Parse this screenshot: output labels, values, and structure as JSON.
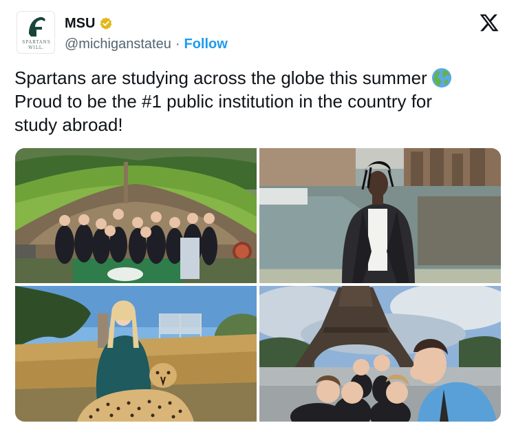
{
  "account": {
    "display_name": "MSU",
    "handle": "@michiganstateu",
    "separator": "·",
    "follow_label": "Follow",
    "avatar_tagline_line1": "SPARTANS",
    "avatar_tagline_line2": "WILL."
  },
  "tweet": {
    "line1": "Spartans are studying across the globe this summer",
    "line2": "Proud to be the #1 public institution in the country for",
    "line3": "study abroad!"
  },
  "icons": {
    "brand": "spartan-helmet-icon",
    "verified": "verified-badge-icon",
    "platform": "x-logo-icon",
    "emoji": "globe-americas-icon"
  },
  "colors": {
    "brand_green": "#18453B",
    "verified_gold": "#E2B719",
    "link_blue": "#1D9BF0",
    "muted_text": "#536471"
  },
  "media": {
    "photos": [
      {
        "description_icon": "group-photo-hobbit-house"
      },
      {
        "description_icon": "man-by-canal"
      },
      {
        "description_icon": "student-with-cheetah"
      },
      {
        "description_icon": "selfie-eiffel-tower"
      }
    ]
  }
}
